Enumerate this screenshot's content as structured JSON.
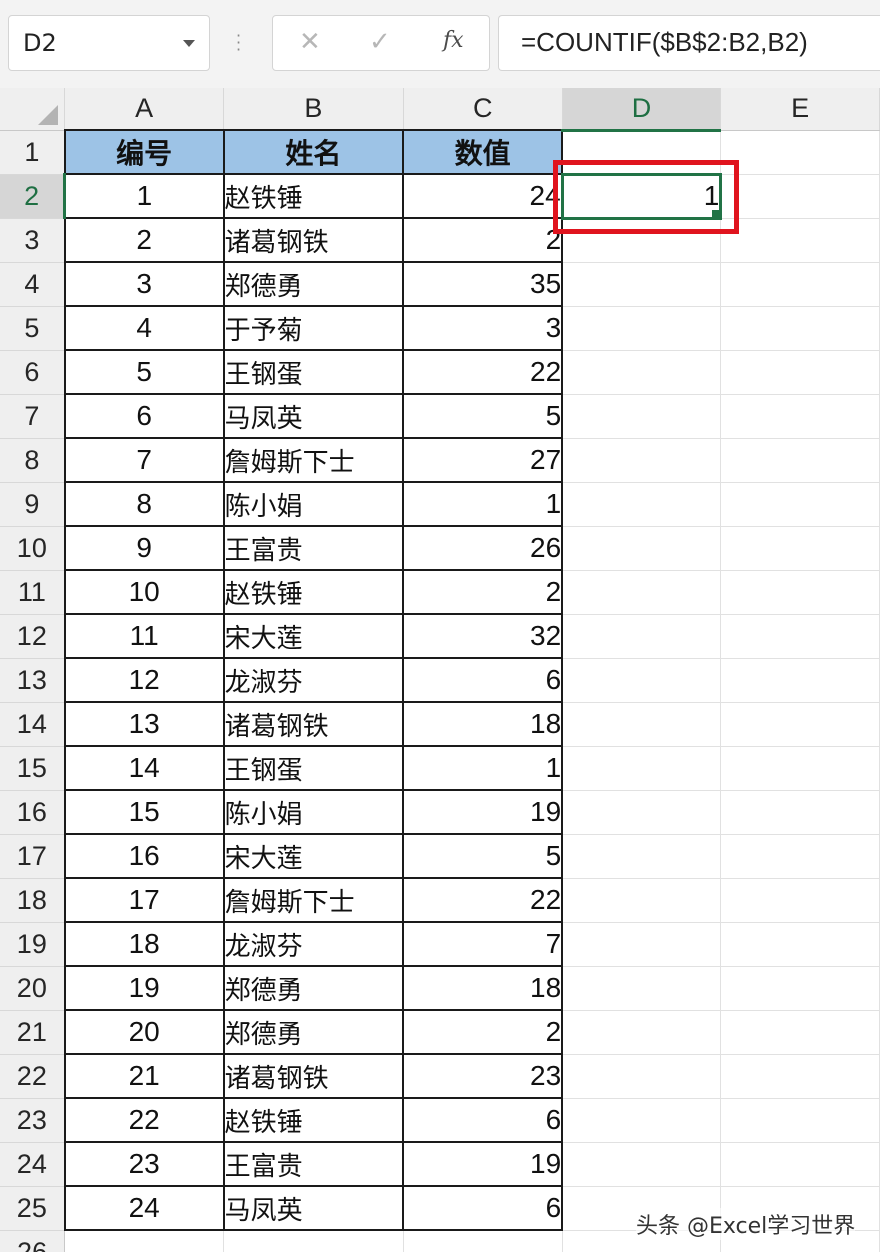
{
  "formula_bar": {
    "name_box": "D2",
    "cancel_symbol": "✕",
    "enter_symbol": "✓",
    "fx_symbol": "fx",
    "formula": "=COUNTIF($B$2:B2,B2)"
  },
  "sheet": {
    "column_headers": [
      "A",
      "B",
      "C",
      "D",
      "E"
    ],
    "selected_column": "D",
    "header_row": {
      "row": "1",
      "a": "编号",
      "b": "姓名",
      "c": "数值"
    },
    "rows": [
      {
        "row": "2",
        "a": "1",
        "b": "赵铁锤",
        "c": "24",
        "d": "1"
      },
      {
        "row": "3",
        "a": "2",
        "b": "诸葛钢铁",
        "c": "2"
      },
      {
        "row": "4",
        "a": "3",
        "b": "郑德勇",
        "c": "35"
      },
      {
        "row": "5",
        "a": "4",
        "b": "于予菊",
        "c": "3"
      },
      {
        "row": "6",
        "a": "5",
        "b": "王钢蛋",
        "c": "22"
      },
      {
        "row": "7",
        "a": "6",
        "b": "马凤英",
        "c": "5"
      },
      {
        "row": "8",
        "a": "7",
        "b": "詹姆斯下士",
        "c": "27"
      },
      {
        "row": "9",
        "a": "8",
        "b": "陈小娟",
        "c": "1"
      },
      {
        "row": "10",
        "a": "9",
        "b": "王富贵",
        "c": "26"
      },
      {
        "row": "11",
        "a": "10",
        "b": "赵铁锤",
        "c": "2"
      },
      {
        "row": "12",
        "a": "11",
        "b": "宋大莲",
        "c": "32"
      },
      {
        "row": "13",
        "a": "12",
        "b": "龙淑芬",
        "c": "6"
      },
      {
        "row": "14",
        "a": "13",
        "b": "诸葛钢铁",
        "c": "18"
      },
      {
        "row": "15",
        "a": "14",
        "b": "王钢蛋",
        "c": "1"
      },
      {
        "row": "16",
        "a": "15",
        "b": "陈小娟",
        "c": "19"
      },
      {
        "row": "17",
        "a": "16",
        "b": "宋大莲",
        "c": "5"
      },
      {
        "row": "18",
        "a": "17",
        "b": "詹姆斯下士",
        "c": "22"
      },
      {
        "row": "19",
        "a": "18",
        "b": "龙淑芬",
        "c": "7"
      },
      {
        "row": "20",
        "a": "19",
        "b": "郑德勇",
        "c": "18"
      },
      {
        "row": "21",
        "a": "20",
        "b": "郑德勇",
        "c": "2"
      },
      {
        "row": "22",
        "a": "21",
        "b": "诸葛钢铁",
        "c": "23"
      },
      {
        "row": "23",
        "a": "22",
        "b": "赵铁锤",
        "c": "6"
      },
      {
        "row": "24",
        "a": "23",
        "b": "王富贵",
        "c": "19"
      },
      {
        "row": "25",
        "a": "24",
        "b": "马凤英",
        "c": "6"
      }
    ],
    "partial_row": "26"
  },
  "colors": {
    "header_fill": "#9dc3e6",
    "selection_green": "#217346",
    "highlight_red": "#e0141e"
  },
  "watermark": "头条 @Excel学习世界"
}
